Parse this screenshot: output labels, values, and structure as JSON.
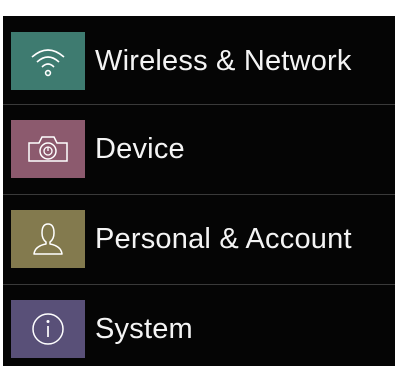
{
  "settings_menu": {
    "items": [
      {
        "label": "Wireless & Network",
        "icon": "wifi-icon",
        "icon_color": "#3e7b70"
      },
      {
        "label": "Device",
        "icon": "device-icon",
        "icon_color": "#8c5a6e"
      },
      {
        "label": "Personal & Account",
        "icon": "person-icon",
        "icon_color": "#837a4e"
      },
      {
        "label": "System",
        "icon": "info-icon",
        "icon_color": "#595078"
      }
    ]
  }
}
